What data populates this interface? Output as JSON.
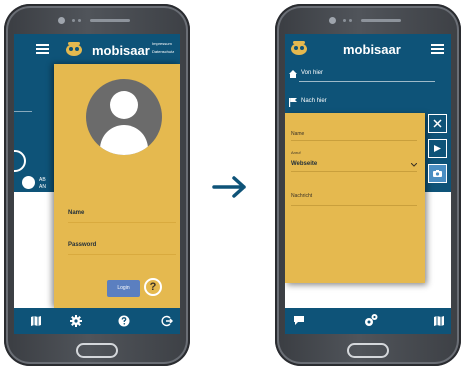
{
  "left_screen": {
    "app_title": "mobisaar",
    "header_links": [
      "Impressum",
      "Datenschutz"
    ],
    "background_labels": [
      "AB",
      "AN"
    ],
    "name_label": "Name",
    "password_label": "Password",
    "login_label": "Login",
    "help_label": "?",
    "bottom_icons": [
      "map-icon",
      "gear-icon",
      "help-circle-icon",
      "logout-icon"
    ]
  },
  "arrow": {
    "icon": "right-arrow-icon",
    "color": "#0e5378"
  },
  "right_screen": {
    "app_title": "mobisaar",
    "from_label": "Von hier",
    "to_label": "Nach hier",
    "feedback": {
      "name_label": "Name",
      "contact_label": "Anruf",
      "contact_value": "Webseite",
      "message_label": "Nachricht"
    },
    "side_buttons": [
      "close-icon",
      "send-icon",
      "camera-icon"
    ],
    "bottom_icons": [
      "chat-icon",
      "gears-icon",
      "map-icon"
    ]
  },
  "colors": {
    "primary": "#0e5378",
    "accent": "#e5b94f",
    "button": "#5b7fc0",
    "phone_body": "#4a4d52"
  }
}
